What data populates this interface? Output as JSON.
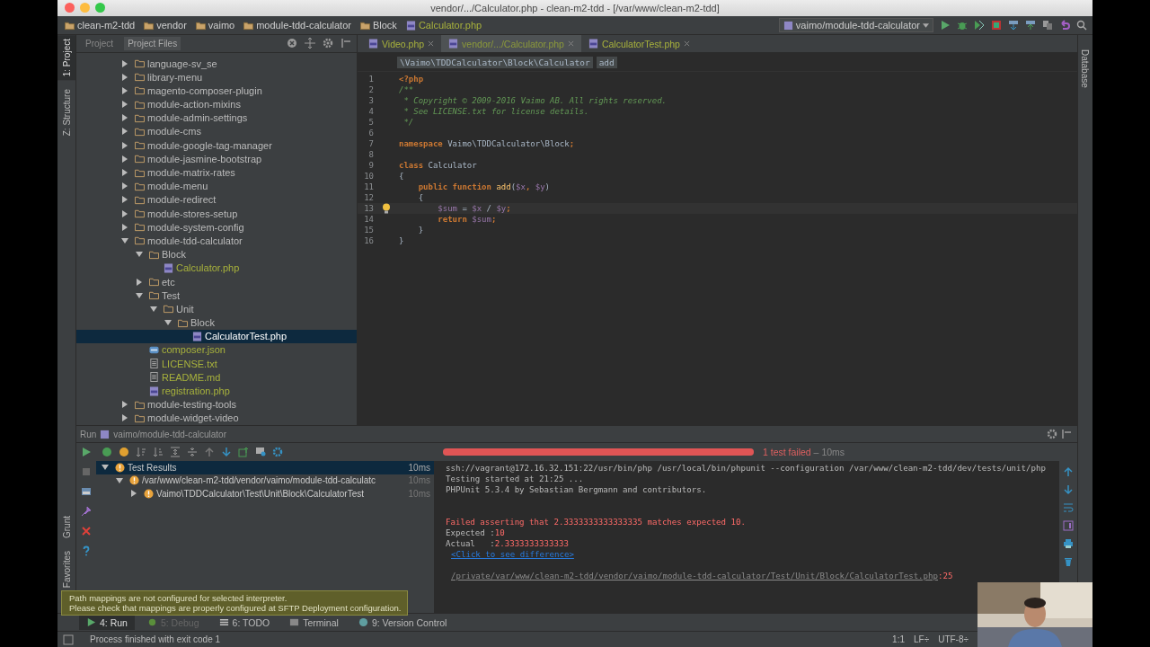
{
  "window": {
    "title": "vendor/.../Calculator.php - clean-m2-tdd - [/var/www/clean-m2-tdd]"
  },
  "breadcrumbs": [
    {
      "label": "clean-m2-tdd",
      "kind": "folder"
    },
    {
      "label": "vendor",
      "kind": "folder"
    },
    {
      "label": "vaimo",
      "kind": "folder"
    },
    {
      "label": "module-tdd-calculator",
      "kind": "folder"
    },
    {
      "label": "Block",
      "kind": "folder"
    },
    {
      "label": "Calculator.php",
      "kind": "php"
    }
  ],
  "run_config": "vaimo/module-tdd-calculator",
  "side_tabs_top": [
    {
      "label": "1: Project",
      "selected": true
    },
    {
      "label": "Z: Structure",
      "selected": false
    }
  ],
  "side_tabs_bottom": [
    {
      "label": "Grunt",
      "selected": false
    },
    {
      "label": "Favorites",
      "selected": false
    }
  ],
  "right_tab": "Database",
  "project_tabs": [
    {
      "label": "Project",
      "selected": false
    },
    {
      "label": "Project Files",
      "selected": true
    }
  ],
  "tree": [
    {
      "label": "language-sv_se",
      "kind": "folder",
      "expanded": false,
      "selected": false
    },
    {
      "label": "library-menu",
      "kind": "folder",
      "expanded": false,
      "selected": false
    },
    {
      "label": "magento-composer-plugin",
      "kind": "folder",
      "expanded": false,
      "selected": false
    },
    {
      "label": "module-action-mixins",
      "kind": "folder",
      "expanded": false,
      "selected": false
    },
    {
      "label": "module-admin-settings",
      "kind": "folder",
      "expanded": false,
      "selected": false
    },
    {
      "label": "module-cms",
      "kind": "folder",
      "expanded": false,
      "selected": false
    },
    {
      "label": "module-google-tag-manager",
      "kind": "folder",
      "expanded": false,
      "selected": false
    },
    {
      "label": "module-jasmine-bootstrap",
      "kind": "folder",
      "expanded": false,
      "selected": false
    },
    {
      "label": "module-matrix-rates",
      "kind": "folder",
      "expanded": false,
      "selected": false
    },
    {
      "label": "module-menu",
      "kind": "folder",
      "expanded": false,
      "selected": false
    },
    {
      "label": "module-redirect",
      "kind": "folder",
      "expanded": false,
      "selected": false
    },
    {
      "label": "module-stores-setup",
      "kind": "folder",
      "expanded": false,
      "selected": false
    },
    {
      "label": "module-system-config",
      "kind": "folder",
      "expanded": false,
      "selected": false
    },
    {
      "label": "module-tdd-calculator",
      "kind": "folder",
      "expanded": true,
      "selected": false,
      "children": [
        {
          "label": "Block",
          "kind": "folder",
          "expanded": true,
          "selected": false,
          "children": [
            {
              "label": "Calculator.php",
              "kind": "php",
              "selected": false,
              "color": "#a8b23c"
            }
          ]
        },
        {
          "label": "etc",
          "kind": "folder",
          "expanded": false,
          "selected": false
        },
        {
          "label": "Test",
          "kind": "folder",
          "expanded": true,
          "selected": false,
          "children": [
            {
              "label": "Unit",
              "kind": "folder",
              "expanded": true,
              "selected": false,
              "children": [
                {
                  "label": "Block",
                  "kind": "folder",
                  "expanded": true,
                  "selected": false,
                  "children": [
                    {
                      "label": "CalculatorTest.php",
                      "kind": "php",
                      "selected": true
                    }
                  ]
                }
              ]
            }
          ]
        },
        {
          "label": "composer.json",
          "kind": "json",
          "selected": false,
          "color": "#a8b23c"
        },
        {
          "label": "LICENSE.txt",
          "kind": "text",
          "selected": false,
          "color": "#a8b23c"
        },
        {
          "label": "README.md",
          "kind": "text",
          "selected": false,
          "color": "#a8b23c"
        },
        {
          "label": "registration.php",
          "kind": "php",
          "selected": false,
          "color": "#a8b23c"
        }
      ]
    },
    {
      "label": "module-testing-tools",
      "kind": "folder",
      "expanded": false,
      "selected": false
    },
    {
      "label": "module-widget-video",
      "kind": "folder",
      "expanded": false,
      "selected": false
    }
  ],
  "editor_tabs": [
    {
      "label": "Video.php",
      "selected": false
    },
    {
      "label": "vendor/.../Calculator.php",
      "selected": true
    },
    {
      "label": "CalculatorTest.php",
      "selected": false
    }
  ],
  "editor_breadcrumbs": [
    "\\Vaimo\\TDDCalculator\\Block\\Calculator",
    "add"
  ],
  "code": [
    {
      "number": "1",
      "current": false,
      "bulb": false,
      "tokens": [
        {
          "t": "<?php",
          "kind": "tag"
        }
      ]
    },
    {
      "number": "2",
      "current": false,
      "bulb": false,
      "tokens": [
        {
          "t": "/**",
          "kind": "comment"
        }
      ]
    },
    {
      "number": "3",
      "current": false,
      "bulb": false,
      "tokens": [
        {
          "t": " * Copyright © 2009-2016 Vaimo AB. All rights reserved.",
          "kind": "comment"
        }
      ]
    },
    {
      "number": "4",
      "current": false,
      "bulb": false,
      "tokens": [
        {
          "t": " * See LICENSE.txt for license details.",
          "kind": "comment"
        }
      ]
    },
    {
      "number": "5",
      "current": false,
      "bulb": false,
      "tokens": [
        {
          "t": " */",
          "kind": "comment"
        }
      ]
    },
    {
      "number": "6",
      "current": false,
      "bulb": false
    },
    {
      "number": "7",
      "current": false,
      "bulb": false,
      "tokens": [
        {
          "t": "namespace",
          "kind": "keyword"
        },
        {
          "t": " Vaimo\\TDDCalculator\\Block",
          "kind": "plain"
        },
        {
          "t": ";",
          "kind": "keyword"
        }
      ]
    },
    {
      "number": "8",
      "current": false,
      "bulb": false
    },
    {
      "number": "9",
      "current": false,
      "bulb": false,
      "tokens": [
        {
          "t": "class",
          "kind": "keyword"
        },
        {
          "t": " Calculator",
          "kind": "plain"
        }
      ]
    },
    {
      "number": "10",
      "current": false,
      "bulb": false,
      "tokens": [
        {
          "t": "{",
          "kind": "plain"
        }
      ]
    },
    {
      "number": "11",
      "current": false,
      "bulb": false,
      "tokens": [
        {
          "t": "    public function ",
          "kind": "keyword"
        },
        {
          "t": "add",
          "kind": "func"
        },
        {
          "t": "(",
          "kind": "plain"
        },
        {
          "t": "$x",
          "kind": "var"
        },
        {
          "t": ", ",
          "kind": "keyword"
        },
        {
          "t": "$y",
          "kind": "var"
        },
        {
          "t": ")",
          "kind": "plain"
        }
      ]
    },
    {
      "number": "12",
      "current": false,
      "bulb": false,
      "tokens": [
        {
          "t": "    {",
          "kind": "plain"
        }
      ]
    },
    {
      "number": "13",
      "current": true,
      "bulb": true,
      "tokens": [
        {
          "t": "        $sum",
          "kind": "var"
        },
        {
          "t": " = ",
          "kind": "plain"
        },
        {
          "t": "$x",
          "kind": "var"
        },
        {
          "t": " / ",
          "kind": "plain"
        },
        {
          "t": "$y",
          "kind": "var"
        },
        {
          "t": ";",
          "kind": "keyword"
        }
      ]
    },
    {
      "number": "14",
      "current": false,
      "bulb": false,
      "tokens": [
        {
          "t": "        return ",
          "kind": "keyword"
        },
        {
          "t": "$sum",
          "kind": "var"
        },
        {
          "t": ";",
          "kind": "keyword"
        }
      ]
    },
    {
      "number": "15",
      "current": false,
      "bulb": false,
      "tokens": [
        {
          "t": "    }",
          "kind": "plain"
        }
      ]
    },
    {
      "number": "16",
      "current": false,
      "bulb": false,
      "tokens": [
        {
          "t": "}",
          "kind": "plain"
        }
      ]
    }
  ],
  "run_panel": {
    "title": "Run",
    "config": "vaimo/module-tdd-calculator",
    "progress": {
      "level": 1.0,
      "status": "1 test failed",
      "duration": " – 10ms"
    },
    "tests": [
      {
        "label": "Test Results",
        "time": "10ms",
        "expanded": true,
        "selected": true,
        "children": [
          {
            "label": "/var/www/clean-m2-tdd/vendor/vaimo/module-tdd-calculatc",
            "time": "10ms",
            "expanded": true,
            "selected": false,
            "children": [
              {
                "label": "Vaimo\\TDDCalculator\\Test\\Unit\\Block\\CalculatorTest",
                "time": "10ms",
                "expanded": false,
                "selected": false
              }
            ]
          }
        ]
      }
    ],
    "console": [
      {
        "kind": "line",
        "parts": [
          {
            "t": "ssh://vagrant@172.16.32.151:22/usr/bin/php /usr/local/bin/phpunit --configuration /var/www/clean-m2-tdd/dev/tests/unit/php",
            "kind": "plain"
          }
        ]
      },
      {
        "kind": "line",
        "parts": [
          {
            "t": "Testing started at 21:25 ...",
            "kind": "plain"
          }
        ]
      },
      {
        "kind": "line",
        "parts": [
          {
            "t": "PHPUnit 5.3.4 by Sebastian Bergmann and contributors.",
            "kind": "plain"
          }
        ]
      },
      {
        "kind": "blank"
      },
      {
        "kind": "blank"
      },
      {
        "kind": "line",
        "parts": [
          {
            "t": "Failed asserting that 2.3333333333333335 matches expected 10.",
            "kind": "error"
          }
        ]
      },
      {
        "kind": "line",
        "parts": [
          {
            "t": "Expected :",
            "kind": "plain"
          },
          {
            "t": "10",
            "kind": "error"
          }
        ]
      },
      {
        "kind": "line",
        "parts": [
          {
            "t": "Actual   :",
            "kind": "plain"
          },
          {
            "t": "2.3333333333333",
            "kind": "error"
          }
        ]
      },
      {
        "kind": "line",
        "parts": [
          {
            "t": "<Click to see difference>",
            "kind": "link"
          }
        ]
      },
      {
        "kind": "blank"
      },
      {
        "kind": "line",
        "parts": [
          {
            "t": "/private/var/www/clean-m2-tdd/vendor/vaimo/module-tdd-calculator/Test/Unit/Block/CalculatorTest.php",
            "kind": "path"
          },
          {
            "t": ":25",
            "kind": "error"
          }
        ]
      }
    ]
  },
  "notification": [
    "Path mappings are not configured for selected interpreter.",
    "Please check that mappings are properly configured at SFTP Deployment configuration."
  ],
  "tool_tabs": [
    {
      "label": "4: Run",
      "kind": "run",
      "selected": true,
      "disabled": false
    },
    {
      "label": "5: Debug",
      "kind": "debug",
      "selected": false,
      "disabled": true
    },
    {
      "label": "6: TODO",
      "kind": "todo",
      "selected": false,
      "disabled": false
    },
    {
      "label": "Terminal",
      "kind": "terminal",
      "selected": false,
      "disabled": false
    },
    {
      "label": "9: Version Control",
      "kind": "vcs",
      "selected": false,
      "disabled": false
    }
  ],
  "status_bar": {
    "message": "Process finished with exit code 1",
    "position": "1:1",
    "line_separator": "LF÷",
    "encoding": "UTF-8÷"
  },
  "webcam": {
    "kind": "picture"
  }
}
